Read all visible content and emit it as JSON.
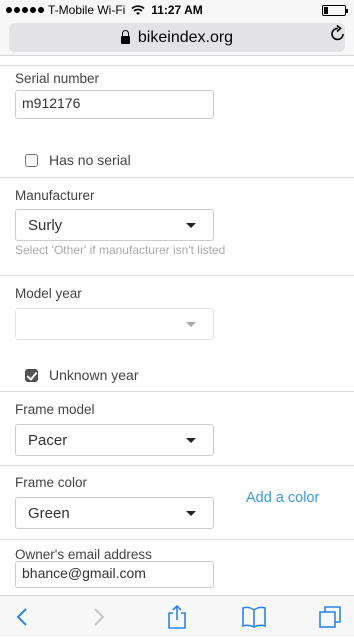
{
  "status_bar": {
    "carrier": "T-Mobile Wi-Fi",
    "time": "11:27 AM",
    "battery_level": 0.2
  },
  "browser": {
    "url": "bikeindex.org"
  },
  "form": {
    "serial_number": {
      "label": "Serial number",
      "value": "m912176"
    },
    "has_no_serial": {
      "label": "Has no serial",
      "checked": false
    },
    "manufacturer": {
      "label": "Manufacturer",
      "value": "Surly",
      "help": "Select 'Other' if manufacturer isn't listed"
    },
    "model_year": {
      "label": "Model year",
      "value": ""
    },
    "unknown_year": {
      "label": "Unknown year",
      "checked": true
    },
    "frame_model": {
      "label": "Frame model",
      "value": "Pacer"
    },
    "frame_color": {
      "label": "Frame color",
      "value": "Green",
      "add_link": "Add a color"
    },
    "owner_email": {
      "label": "Owner's email address",
      "value": "bhance@gmail.com"
    }
  },
  "colors": {
    "accent": "#3a9ad9",
    "toolbar_icon": "#2f86e0"
  },
  "toolbar": {
    "icons": [
      "back-icon",
      "forward-icon",
      "share-icon",
      "bookmarks-icon",
      "tabs-icon"
    ]
  }
}
